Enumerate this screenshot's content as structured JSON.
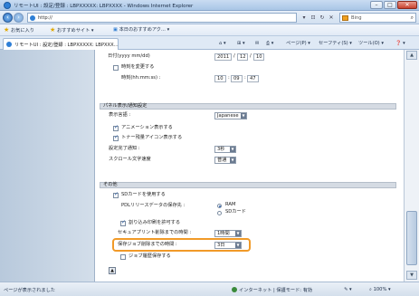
{
  "window": {
    "title": "リモートUI : 設定/登録 : LBPXXXXX: LBPXXXX - Windows Internet Explorer"
  },
  "address_bar": {
    "url": "http://",
    "search_placeholder": "Bing"
  },
  "favorites_bar": {
    "favorites_label": "お気に入り",
    "suggested_sites": "おすすめサイト ▾",
    "today_news": "本日のおすすめアク... ▾"
  },
  "tab": {
    "label": "リモートUI : 設定/登録 : LBPXXXXX: LBPXXX..."
  },
  "command_bar": {
    "page": "ページ(P) ▾",
    "safety": "セーフティ(S) ▾",
    "tools": "ツール(O) ▾",
    "help": "❓ ▾"
  },
  "date_section": {
    "date_label": "日付(yyyy mm/dd)",
    "year": "2011",
    "month": "12",
    "day": "10",
    "change_time_label": "時刻を変更する",
    "time_label": "時刻(hh:mm:ss) :",
    "hour": "10",
    "minute": "09",
    "second": "47"
  },
  "panel_section": {
    "header": "パネル表示/通知設定",
    "language_label": "表示言語 :",
    "language_value": "Japanese",
    "animation_label": "アニメーション表示する",
    "toner_icon_label": "トナー残量アイコン表示する",
    "confirm_label": "設定完了通知 :",
    "confirm_value": "3秒",
    "scroll_label": "スクロール文字速度",
    "scroll_value": "普通"
  },
  "other_section": {
    "header": "その他",
    "sd_card_label": "SDカードを使用する",
    "retain_label": "PDLリリースデータの保存先 :",
    "retain_ram": "RAM",
    "retain_sd": "SDカード",
    "multi_print_label": "割り込み印刷を許可する",
    "secure_print_label": "セキュアプリント削除までの時間 :",
    "secure_print_value": "1時間",
    "job_retention_label": "保存ジョブ削除までの時間 :",
    "job_retention_value": "3日",
    "job_history_label": "ジョブ履歴保存する"
  },
  "status_bar": {
    "status_text": "ページが表示されました",
    "zone": "インターネット | 保護モード: 有効",
    "zoom": "100%"
  },
  "colors": {
    "highlight": "#f19a28",
    "section_header": "#d5dbe3"
  }
}
